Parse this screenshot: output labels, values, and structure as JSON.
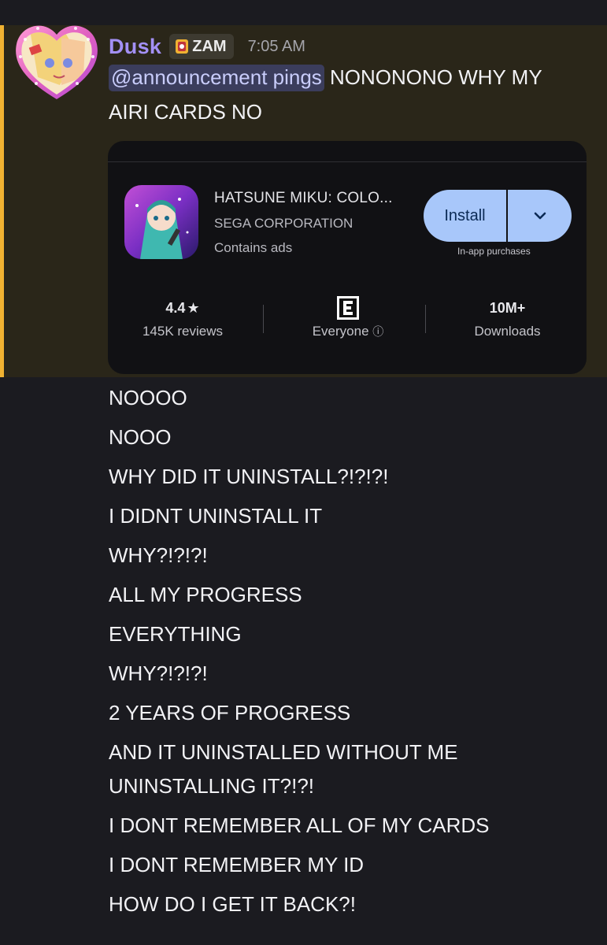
{
  "message": {
    "username": "Dusk",
    "tag": "ZAM",
    "timestamp": "7:05 AM",
    "mention": "@announcement pings",
    "first_line_rest": " NONONONO WHY MY",
    "second_line": "AIRI CARDS NO"
  },
  "embed": {
    "app_title": "HATSUNE MIKU: COLO...",
    "developer": "SEGA CORPORATION",
    "ads": "Contains ads",
    "install_label": "Install",
    "in_app": "In-app purchases",
    "rating": "4.4",
    "reviews": "145K reviews",
    "rating_label": "Everyone",
    "downloads": "10M+",
    "downloads_label": "Downloads"
  },
  "followups": [
    "NOOOO",
    "NOOO",
    "WHY DID IT UNINSTALL?!?!?!",
    "I DIDNT UNINSTALL IT",
    "WHY?!?!?!",
    "ALL MY PROGRESS",
    "EVERYTHING",
    "WHY?!?!?!",
    "2 YEARS OF PROGRESS",
    "AND IT UNINSTALLED WITHOUT ME",
    "UNINSTALLING IT?!?!",
    "I DONT REMEMBER ALL OF MY CARDS",
    "I DONT REMEMBER MY ID",
    "HOW DO I GET IT BACK?!"
  ],
  "colors": {
    "accent_bar": "#f0b232",
    "username": "#a390f5",
    "install_button": "#a8c7fa"
  }
}
